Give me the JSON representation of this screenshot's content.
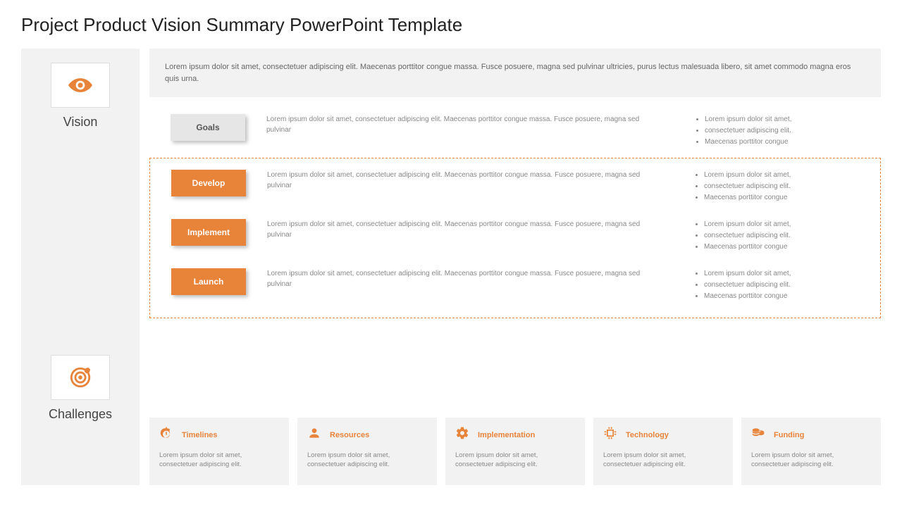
{
  "title": "Project Product Vision Summary PowerPoint Template",
  "sidebar": {
    "vision_label": "Vision",
    "challenges_label": "Challenges"
  },
  "intro": "Lorem ipsum dolor sit amet, consectetuer adipiscing elit. Maecenas porttitor congue massa. Fusce posuere, magna sed pulvinar ultricies, purus lectus malesuada libero, sit amet commodo  magna eros quis urna.",
  "phases": [
    {
      "label": "Goals",
      "desc": "Lorem ipsum dolor sit amet, consectetuer adipiscing elit. Maecenas porttitor congue massa. Fusce posuere, magna sed pulvinar",
      "b1": "Lorem ipsum dolor sit amet,",
      "b2": "consectetuer adipiscing elit.",
      "b3": "Maecenas porttitor congue"
    },
    {
      "label": "Develop",
      "desc": "Lorem ipsum dolor sit amet, consectetuer adipiscing elit. Maecenas porttitor congue massa. Fusce posuere, magna sed pulvinar",
      "b1": "Lorem ipsum dolor sit amet,",
      "b2": "consectetuer adipiscing elit.",
      "b3": "Maecenas porttitor congue"
    },
    {
      "label": "Implement",
      "desc": "Lorem ipsum dolor sit amet, consectetuer adipiscing elit. Maecenas porttitor congue massa. Fusce posuere, magna sed pulvinar",
      "b1": "Lorem ipsum dolor sit amet,",
      "b2": "consectetuer adipiscing elit.",
      "b3": "Maecenas porttitor congue"
    },
    {
      "label": "Launch",
      "desc": "Lorem ipsum dolor sit amet, consectetuer adipiscing elit. Maecenas porttitor congue massa. Fusce posuere, magna sed pulvinar",
      "b1": "Lorem ipsum dolor sit amet,",
      "b2": "consectetuer adipiscing elit.",
      "b3": "Maecenas porttitor congue"
    }
  ],
  "cards": [
    {
      "title": "Timelines",
      "body": "Lorem ipsum dolor sit amet, consectetuer adipiscing elit."
    },
    {
      "title": "Resources",
      "body": "Lorem ipsum dolor sit amet, consectetuer adipiscing elit."
    },
    {
      "title": "Implementation",
      "body": "Lorem ipsum dolor sit amet, consectetuer adipiscing elit."
    },
    {
      "title": "Technology",
      "body": "Lorem ipsum dolor sit amet, consectetuer adipiscing elit."
    },
    {
      "title": "Funding",
      "body": "Lorem ipsum dolor sit amet, consectetuer adipiscing elit."
    }
  ]
}
